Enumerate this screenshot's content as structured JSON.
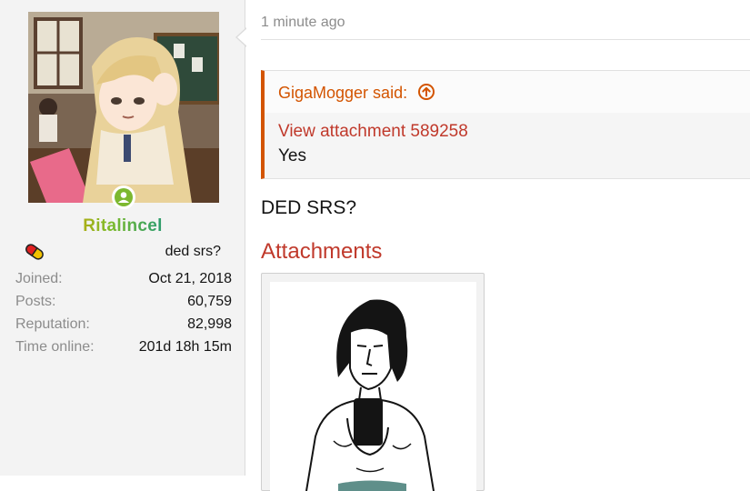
{
  "user": {
    "username": "Ritalincel",
    "title": "ded srs?",
    "online": true,
    "stats": [
      {
        "label": "Joined:",
        "value": "Oct 21, 2018"
      },
      {
        "label": "Posts:",
        "value": "60,759"
      },
      {
        "label": "Reputation:",
        "value": "82,998"
      },
      {
        "label": "Time online:",
        "value": "201d 18h 15m"
      }
    ]
  },
  "message": {
    "timestamp": "1 minute ago",
    "quote": {
      "author_line": "GigaMogger said:",
      "attachment_link": "View attachment 589258",
      "text": "Yes"
    },
    "body": "DED SRS?",
    "attachments_title": "Attachments"
  },
  "colors": {
    "accent": "#d35400",
    "link": "#c0392b",
    "online": "#7cb82f",
    "muted": "#8c8c8c"
  },
  "icons": {
    "online": "online-status-icon",
    "quote_jump": "arrow-up-circle-icon",
    "pill": "pill-icon"
  }
}
